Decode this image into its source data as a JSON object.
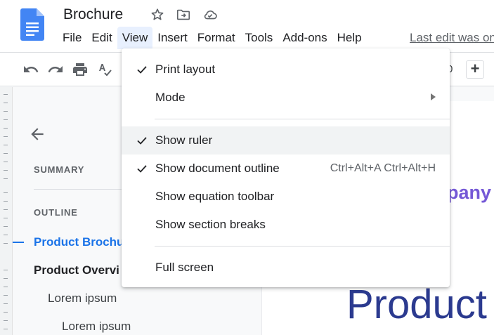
{
  "app": {
    "title": "Brochure",
    "last_edit": "Last edit was on"
  },
  "menu": [
    {
      "label": "File"
    },
    {
      "label": "Edit"
    },
    {
      "label": "View"
    },
    {
      "label": "Insert"
    },
    {
      "label": "Format"
    },
    {
      "label": "Tools"
    },
    {
      "label": "Add-ons"
    },
    {
      "label": "Help"
    }
  ],
  "toolbar": {
    "zoom_partial": "0",
    "plus_label": "+"
  },
  "outline": {
    "summary_label": "SUMMARY",
    "outline_label": "OUTLINE",
    "items": [
      {
        "label": "Product Brochu"
      },
      {
        "label": "Product Overvi"
      },
      {
        "label": "Lorem ipsum"
      },
      {
        "label": "Lorem ipsum"
      }
    ]
  },
  "page": {
    "company_fragment": "pany",
    "product_heading": "Product"
  },
  "view_menu": {
    "items": [
      {
        "label": "Print layout",
        "checked": true
      },
      {
        "label": "Mode",
        "submenu": true
      },
      {
        "label": "Show ruler",
        "checked": true
      },
      {
        "label": "Show document outline",
        "checked": true,
        "shortcut": "Ctrl+Alt+A Ctrl+Alt+H"
      },
      {
        "label": "Show equation toolbar"
      },
      {
        "label": "Show section breaks"
      },
      {
        "label": "Full screen"
      }
    ]
  },
  "colors": {
    "accent": "#1a73e8",
    "company_purple": "#7559d6",
    "product_navy": "#2b3a8f"
  },
  "icons": [
    "docs-logo-icon",
    "star-icon",
    "move-folder-icon",
    "cloud-saved-icon",
    "undo-icon",
    "redo-icon",
    "print-icon",
    "spellcheck-icon",
    "back-arrow-icon",
    "check-icon",
    "submenu-arrow-icon"
  ]
}
